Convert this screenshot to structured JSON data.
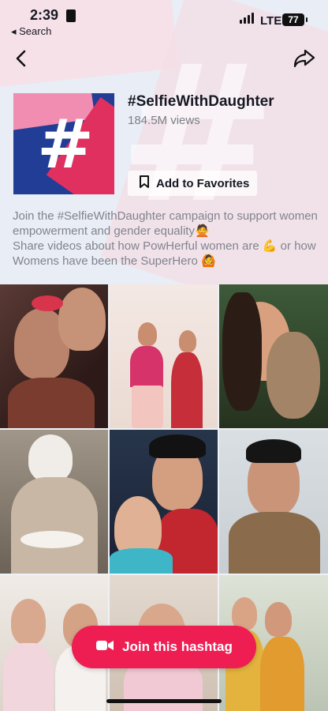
{
  "status_bar": {
    "time": "2:39",
    "back_app": "◂ Search",
    "network": "LTE",
    "battery": "77"
  },
  "tag": {
    "title": "#SelfieWithDaughter",
    "views": "184.5M views",
    "favorite_label": "Add to Favorites",
    "tile_symbol": "#",
    "description": [
      "Join the #SelfieWithDaughter campaign to support women empowerment and gender equality🙅",
      "Share videos about how PowHerful women are 💪 or how Womens have been the SuperHero 🙆"
    ]
  },
  "grid": {
    "tiles": [
      {
        "name": "video-1"
      },
      {
        "name": "video-2"
      },
      {
        "name": "video-3"
      },
      {
        "name": "video-4"
      },
      {
        "name": "video-5"
      },
      {
        "name": "video-6"
      },
      {
        "name": "video-7"
      },
      {
        "name": "video-8"
      },
      {
        "name": "video-9"
      }
    ]
  },
  "join": {
    "label": "Join this hashtag",
    "color": "#ee1d52"
  },
  "icons": {
    "back": "chevron-left-icon",
    "share": "share-arrow-icon",
    "bookmark": "bookmark-icon",
    "camera": "video-camera-icon"
  }
}
